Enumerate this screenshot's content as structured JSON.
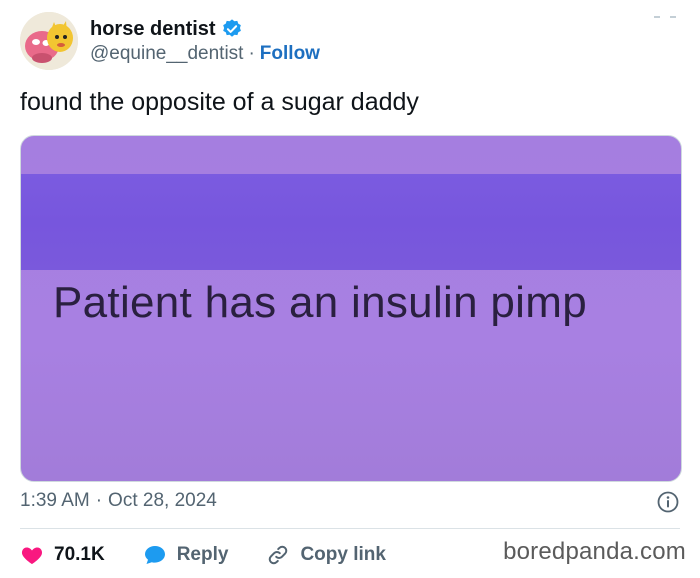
{
  "author": {
    "display_name": "horse dentist",
    "handle": "@equine__dentist",
    "separator": "·",
    "follow_label": "Follow"
  },
  "tweet": {
    "text": "found the opposite of a sugar daddy",
    "image_caption": "Patient has an insulin pimp",
    "time": "1:39 AM",
    "date": "Oct 28, 2024"
  },
  "actions": {
    "likes": "70.1K",
    "reply_label": "Reply",
    "copy_link_label": "Copy link"
  },
  "watermark": "boredpanda.com",
  "icons": {
    "verified": "verified-badge-icon",
    "more": "more-options-icon",
    "info": "info-icon",
    "like": "heart-icon",
    "reply": "reply-bubble-icon",
    "copy": "link-icon"
  },
  "colors": {
    "accent": "#1d6fc0",
    "verified": "#1d9bf0",
    "like": "#f91880",
    "text": "#0f1419",
    "muted": "#536471",
    "media_band": "#7b5be0",
    "media_bg": "#a57ee0"
  }
}
